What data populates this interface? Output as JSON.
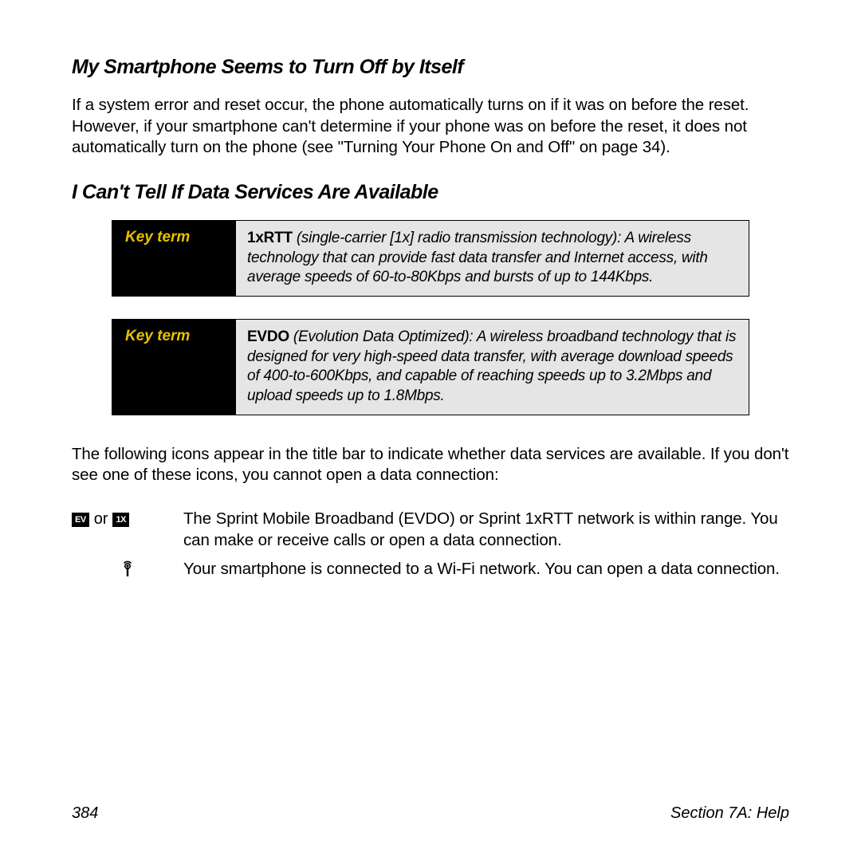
{
  "headings": {
    "h1": "My Smartphone Seems to Turn Off by Itself",
    "h2": "I Can't Tell If Data Services Are Available"
  },
  "paragraphs": {
    "p1": "If a system error and reset occur, the phone automatically turns on if it was on before the reset. However, if your smartphone can't determine if your phone was on before the reset, it does not automatically turn on the phone (see \"Turning Your Phone On and Off\" on page 34).",
    "p2": "The following icons appear in the title bar to indicate whether data services are available. If you don't see one of these icons, you cannot open a data connection:"
  },
  "keyterms": {
    "label": "Key term",
    "kt1_bold": "1xRTT",
    "kt1_rest": " (single-carrier [1x] radio transmission technology): A wireless technology that can provide fast data transfer and Internet access, with average speeds of 60-to-80Kbps and bursts of up to 144Kbps.",
    "kt2_bold": "EVDO",
    "kt2_rest": " (Evolution Data Optimized): A wireless broadband technology that is designed for very high-speed data transfer, with average download speeds of 400-to-600Kbps, and capable of reaching speeds up to 3.2Mbps and upload speeds up to 1.8Mbps."
  },
  "icons": {
    "ev": "EV",
    "onex": "1X",
    "or": " or ",
    "row1": "The Sprint Mobile Broadband (EVDO) or Sprint 1xRTT network is within range. You can make or receive calls or open a data connection.",
    "row2": "Your smartphone is connected to a Wi-Fi network. You can open a data connection."
  },
  "footer": {
    "page": "384",
    "section": "Section 7A: Help"
  }
}
